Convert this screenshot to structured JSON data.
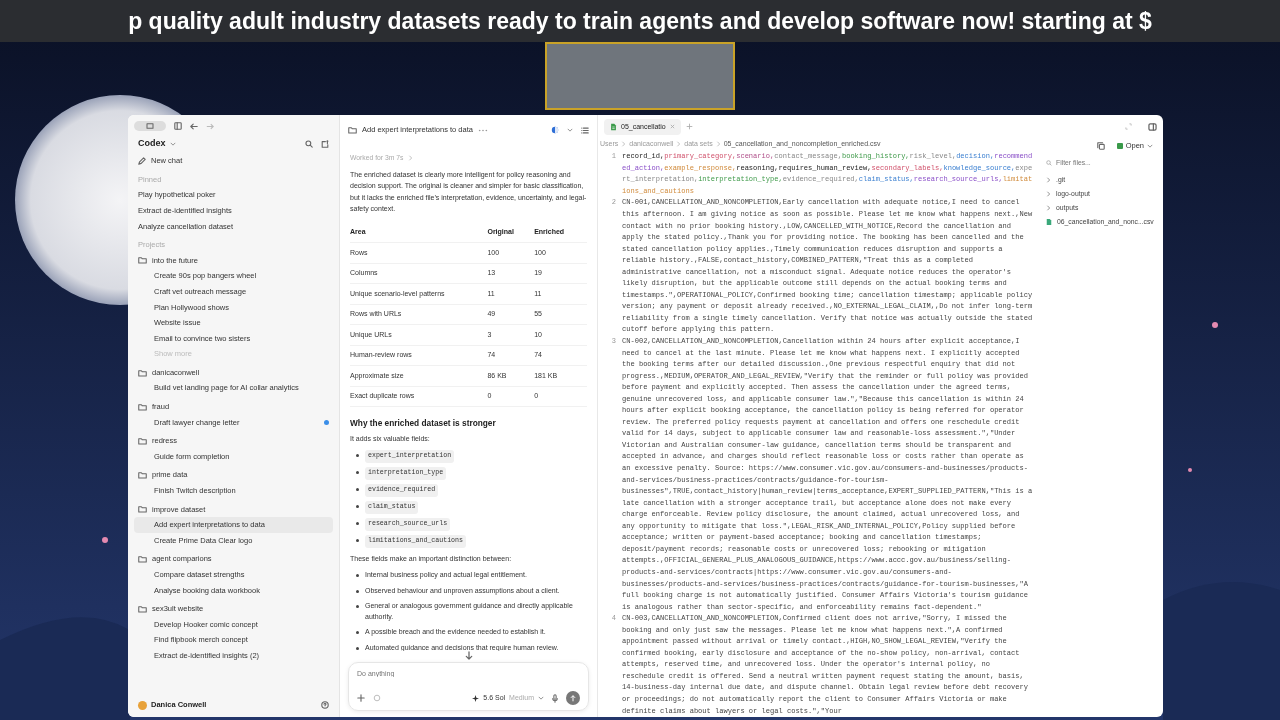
{
  "banner": {
    "text": "p quality adult industry datasets ready to train agents and develop software now! starting at $"
  },
  "sidebar": {
    "app_title": "Codex",
    "new_chat": "New chat",
    "pinned": {
      "heading": "Pinned",
      "items": [
        {
          "label": "Play hypothetical poker",
          "selected": false
        },
        {
          "label": "Extract de-identified insights",
          "selected": false
        },
        {
          "label": "Analyze cancellation dataset",
          "selected": false
        }
      ]
    },
    "projects_heading": "Projects",
    "projects": [
      {
        "name": "into the future",
        "children": [
          {
            "label": "Create 90s pop bangers wheel",
            "selected": false,
            "unread": false
          },
          {
            "label": "Craft vet outreach message",
            "selected": false,
            "unread": false
          },
          {
            "label": "Plan Hollywood shows",
            "selected": false,
            "unread": false
          },
          {
            "label": "Website issue",
            "selected": false,
            "unread": false
          },
          {
            "label": "Email to convince two sisters",
            "selected": false,
            "unread": false
          }
        ],
        "show_more": "Show more"
      },
      {
        "name": "danicaconwell",
        "children": [
          {
            "label": "Build vet landing page for AI collar analytics",
            "selected": false,
            "unread": false
          }
        ]
      },
      {
        "name": "fraud",
        "children": [
          {
            "label": "Draft lawyer change letter",
            "selected": false,
            "unread": true
          }
        ]
      },
      {
        "name": "redress",
        "children": [
          {
            "label": "Guide form completion",
            "selected": false,
            "unread": false
          }
        ]
      },
      {
        "name": "prime data",
        "children": [
          {
            "label": "Finish Twitch description",
            "selected": false,
            "unread": false
          }
        ]
      },
      {
        "name": "improve dataset",
        "children": [
          {
            "label": "Add expert interpretations to data",
            "selected": true,
            "unread": false
          },
          {
            "label": "Create Prime Data Clear logo",
            "selected": false,
            "unread": false
          }
        ]
      },
      {
        "name": "agent comparions",
        "children": [
          {
            "label": "Compare dataset strengths",
            "selected": false,
            "unread": false
          },
          {
            "label": "Analyse booking data workbook",
            "selected": false,
            "unread": false
          }
        ]
      },
      {
        "name": "sex3ult website",
        "children": [
          {
            "label": "Develop Hooker comic concept",
            "selected": false,
            "unread": false
          },
          {
            "label": "Find flipbook merch concept",
            "selected": false,
            "unread": false
          },
          {
            "label": "Extract de-identified insights (2)",
            "selected": false,
            "unread": false
          }
        ]
      }
    ],
    "user": "Danica Conwell"
  },
  "chat": {
    "title": "Add expert interpretations to data",
    "worked": "Worked for 3m 7s",
    "intro": "The enriched dataset is clearly more intelligent for policy reasoning and decision support. The original is cleaner and simpler for basic classification, but it lacks the enriched file’s interpretation, evidence, uncertainty, and legal-safety context.",
    "table": {
      "columns": [
        "Area",
        "Original",
        "Enriched"
      ],
      "rows": [
        [
          "Rows",
          "100",
          "100"
        ],
        [
          "Columns",
          "13",
          "19"
        ],
        [
          "Unique scenario-level patterns",
          "11",
          "11"
        ],
        [
          "Rows with URLs",
          "49",
          "55"
        ],
        [
          "Unique URLs",
          "3",
          "10"
        ],
        [
          "Human-review rows",
          "74",
          "74"
        ],
        [
          "Approximate size",
          "86 KB",
          "181 KB"
        ],
        [
          "Exact duplicate rows",
          "0",
          "0"
        ]
      ]
    },
    "heading": "Why the enriched dataset is stronger",
    "fields_intro": "It adds six valuable fields:",
    "fields": [
      "expert_interpretation",
      "interpretation_type",
      "evidence_required",
      "claim_status",
      "research_source_urls",
      "limitations_and_cautions"
    ],
    "distinction_intro": "These fields make an important distinction between:",
    "distinctions": [
      "Internal business policy and actual legal entitlement.",
      "Observed behaviour and unproven assumptions about a client.",
      "General or analogous government guidance and directly applicable authority.",
      "A possible breach and the evidence needed to establish it.",
      "Automated guidance and decisions that require human review."
    ],
    "composer": {
      "placeholder": "Do anything",
      "model": "5.6 Sol",
      "effort": "Medium"
    }
  },
  "editor": {
    "tabs": [
      {
        "label": "05_cancellatio",
        "selected": true
      }
    ],
    "breadcrumb": [
      "Users",
      "danicaconwell",
      "data sets",
      "05_cancellation_and_noncompletion_enriched.csv"
    ],
    "header": {
      "number": "1",
      "tokens": [
        "record_id,",
        "primary_category,",
        "scenario,",
        "contact_message,",
        "booking_history,",
        "risk_level,",
        "decision,",
        "recommended_action,",
        "example_response,",
        "reasoning,",
        "requires_human_review,",
        "secondary_labels,",
        "knowledge_source,",
        "expert_interpretation,",
        "interpretation_type,",
        "evidence_required,",
        "claim_status,",
        "research_source_urls,",
        "limitations_and_cautions"
      ]
    },
    "lines": [
      {
        "number": "2",
        "text": "CN-001,CANCELLATION_AND_NONCOMPLETION,Early cancellation with adequate notice,I need to cancel this afternoon. I am giving notice as soon as possible. Please let me know what happens next.,New contact with no prior booking history.,LOW,CANCELLED_WITH_NOTICE,Record the cancellation and apply the stated policy.,Thank you for providing notice. The booking has been cancelled and the stated cancellation policy applies.,Timely communication reduces disruption and supports a reliable history.,FALSE,contact_history,COMBINED_PATTERN,\"Treat this as a completed administrative cancellation, not a misconduct signal. Adequate notice reduces the operator's likely disruption, but the applicable outcome still depends on the actual booking terms and timestamps.\",OPERATIONAL_POLICY,Confirmed booking time; cancellation timestamp; applicable policy version; any payment or deposit already received.,NO_EXTERNAL_LEGAL_CLAIM,,Do not infer long-term reliability from a single timely cancellation. Verify that notice was actually outside the stated cutoff before applying this pattern."
      },
      {
        "number": "3",
        "text": "CN-002,CANCELLATION_AND_NONCOMPLETION,Cancellation within 24 hours after explicit acceptance,I need to cancel at the last minute. Please let me know what happens next. I explicitly accepted the booking terms after our detailed discussion.,One previous respectful enquiry that did not progress.,MEDIUM,OPERATOR_AND_LEGAL_REVIEW,\"Verify that the reminder or full policy was provided before payment and explicitly accepted. Then assess the cancellation under the agreed terms, genuine unrecovered loss, and applicable consumer law.\",\"Because this cancellation is within 24 hours after explicit booking acceptance, the cancellation policy is being referred for operator review. The preferred policy requests payment at cancellation and offers one reschedule credit valid for 14 days, subject to applicable consumer law and reasonable-loss assessment.\",\"Under Victorian and Australian consumer-law guidance, cancellation terms should be transparent and accepted in advance, and charges should reflect reasonable loss or costs rather than operate as an excessive penalty. Source: https://www.consumer.vic.gov.au/consumers-and-businesses/products-and-services/business-practices/contracts/guidance-for-tourism-businesses\",TRUE,contact_history|human_review|terms_acceptance,EXPERT_SUPPLIED_PATTERN,\"This is a late cancellation with a stronger acceptance trail, but acceptance alone does not make every charge enforceable. Review policy disclosure, the amount claimed, actual unrecovered loss, and any opportunity to mitigate that loss.\",LEGAL_RISK_AND_INTERNAL_POLICY,Policy supplied before acceptance; written or payment-based acceptance; booking and cancellation timestamps; deposit/payment records; reasonable costs or unrecovered loss; rebooking or mitigation attempts.,OFFICIAL_GENERAL_PLUS_ANALOGOUS_GUIDANCE,https://www.accc.gov.au/business/selling-products-and-services/contracts|https://www.consumer.vic.gov.au/consumers-and-businesses/products-and-services/business-practices/contracts/guidance-for-tourism-businesses,\"A full booking charge is not automatically justified. Consumer Affairs Victoria's tourism guidance is analogous rather than sector-specific, and enforceability remains fact-dependent.\""
      },
      {
        "number": "4",
        "text": "CN-003,CANCELLATION_AND_NONCOMPLETION,Confirmed client does not arrive,\"Sorry, I missed the booking and only just saw the messages. Please let me know what happens next.\",A confirmed appointment passed without arrival or timely contact.,HIGH,NO_SHOW_LEGAL_REVIEW,\"Verify the confirmed booking, early disclosure and acceptance of the no-show policy, non-arrival, contact attempts, reserved time, and unrecovered loss. Under the operator's internal policy, no reschedule credit is offered. Send a neutral written payment request stating the amount, basis, 14-business-day internal due date, and dispute channel. Obtain legal review before debt recovery or proceedings; do not automatically report the client to Consumer Affairs Victoria or make definite claims about lawyers or legal costs.\",\"Your"
      }
    ]
  },
  "files": {
    "open_button": "Open",
    "filter_placeholder": "Filter files...",
    "items": [
      {
        "kind": "folder",
        "name": ".git",
        "expanded": false
      },
      {
        "kind": "folder",
        "name": "logo-output",
        "expanded": false
      },
      {
        "kind": "folder",
        "name": "outputs",
        "expanded": false
      },
      {
        "kind": "file",
        "name": "06_cancellation_and_nonc...csv"
      }
    ]
  }
}
